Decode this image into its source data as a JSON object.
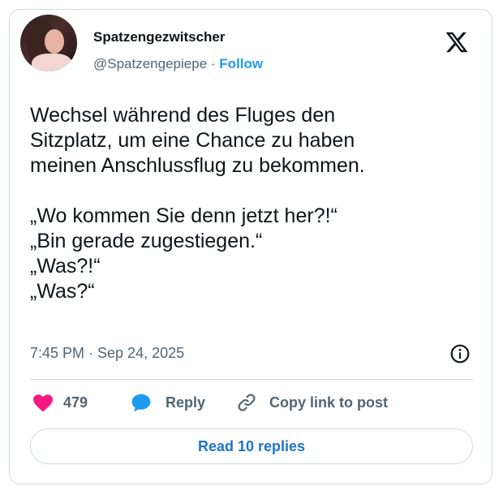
{
  "author": {
    "display_name": "Spatzengezwitscher",
    "handle": "@Spatzengepiepe",
    "separator": "·",
    "follow_label": "Follow"
  },
  "tweet": {
    "text": "Wechsel während des Fluges den\nSitzplatz, um eine Chance zu haben\nmeinen Anschlussflug zu bekommen.\n\n„Wo kommen Sie denn jetzt her?!“\n„Bin gerade zugestiegen.“\n„Was?!“\n„Was?“",
    "timestamp": "7:45 PM · Sep 24, 2025"
  },
  "actions": {
    "like_count": "479",
    "reply_label": "Reply",
    "copy_label": "Copy link to post",
    "read_replies_label": "Read 10 replies"
  },
  "colors": {
    "like": "#f91880",
    "reply": "#1d9bf0",
    "link": "#1d9bf0",
    "secondary_text": "#536471"
  },
  "icons": {
    "brand": "x-logo-icon",
    "info": "info-icon",
    "like": "heart-icon",
    "reply": "speech-bubble-icon",
    "copy": "link-icon"
  }
}
